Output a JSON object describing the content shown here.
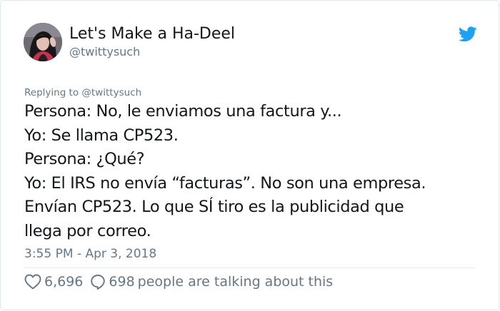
{
  "tweet": {
    "author_name": "Let's Make a Ha-Deel",
    "author_handle": "@twittysuch",
    "replying_prefix": "Replying to",
    "replying_handle": "@twittysuch",
    "body_lines": [
      "Persona: No, le enviamos una factura y...",
      "Yo: Se llama CP523.",
      "Persona: ¿Qué?",
      "Yo: El IRS no envía “facturas”. No son una empresa.",
      "Envían CP523. Lo que SÍ  tiro es la publicidad que",
      "llega por correo."
    ],
    "timestamp": "3:55 PM - Apr 3, 2018",
    "likes": "6,696",
    "replies": "698",
    "talking_text": "people are talking about this"
  },
  "icons": {
    "brand": "twitter-bird-icon",
    "like": "heart-icon",
    "reply": "speech-bubble-icon"
  },
  "colors": {
    "twitter_blue": "#1da1f2",
    "text_primary": "#14171a",
    "text_secondary": "#657786",
    "border": "#e1e8ed"
  }
}
